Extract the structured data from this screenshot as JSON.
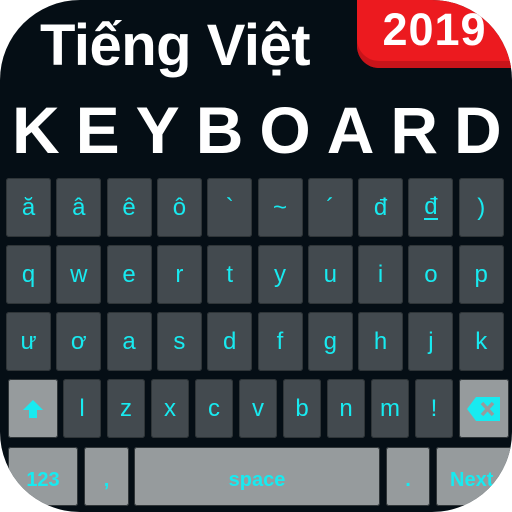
{
  "header": {
    "title_line1": "Tiếng Việt",
    "title_line2": "KEYBOARD",
    "badge": "2019"
  },
  "colors": {
    "background": "#050e15",
    "key_dark": "#434a4f",
    "key_light": "#969b9d",
    "key_text": "#18eaf0",
    "badge": "#ec1a1f"
  },
  "keyboard": {
    "row1": [
      "ă",
      "â",
      "ê",
      "ô",
      "`",
      "~",
      "´",
      "đ",
      "đ",
      ")"
    ],
    "row2": [
      "q",
      "w",
      "e",
      "r",
      "t",
      "y",
      "u",
      "i",
      "o",
      "p"
    ],
    "row3": [
      "ư",
      "ơ",
      "a",
      "s",
      "d",
      "f",
      "g",
      "h",
      "j",
      "k"
    ],
    "row4": [
      "l",
      "z",
      "x",
      "c",
      "v",
      "b",
      "n",
      "m",
      "!"
    ],
    "shift_icon": "shift-arrow-icon",
    "backspace_icon": "backspace-icon",
    "numbers_label": "123",
    "comma_label": ",",
    "space_label": "space",
    "period_label": ".",
    "next_label": "Next"
  }
}
